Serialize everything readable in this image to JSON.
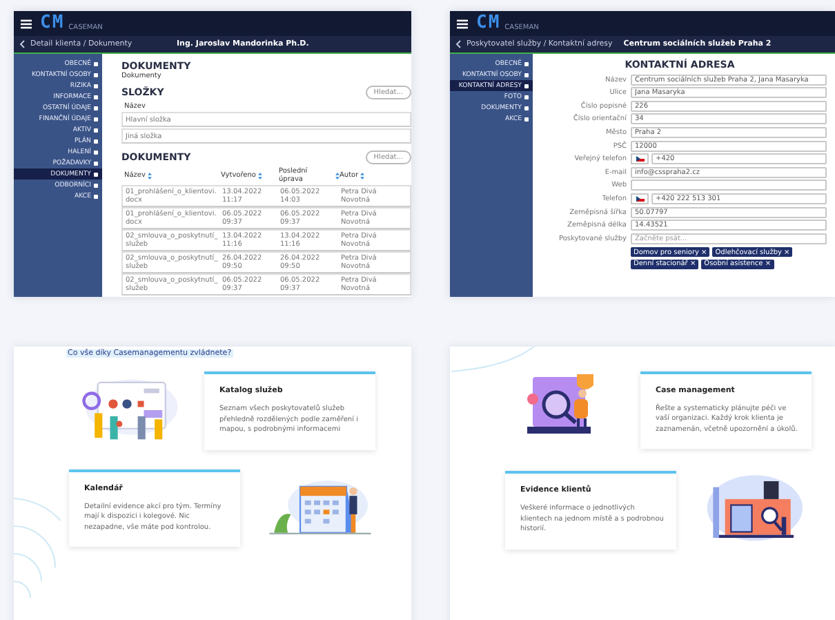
{
  "app_screens": [
    {
      "kind": "documents",
      "logo": "CM",
      "logo_caption": "CASEMAN",
      "breadcrumb": "Detail klienta / Dokumenty",
      "title": "Ing. Jaroslav Mandorinka Ph.D.",
      "menu": [
        {
          "label": "OBECNÉ",
          "selected": false
        },
        {
          "label": "KONTAKTNÍ OSOBY",
          "selected": false
        },
        {
          "label": "RIZIKA",
          "selected": false
        },
        {
          "label": "INFORMACE",
          "selected": false
        },
        {
          "label": "OSTATNÍ ÚDAJE",
          "selected": false
        },
        {
          "label": "FINANČNÍ ÚDAJE",
          "selected": false
        },
        {
          "label": "AKTIV",
          "selected": false
        },
        {
          "label": "PLÁN",
          "selected": false
        },
        {
          "label": "HALENÍ",
          "selected": false
        },
        {
          "label": "POŽADAVKY",
          "selected": false
        },
        {
          "label": "DOKUMENTY",
          "selected": true
        },
        {
          "label": "ODBORNÍCI",
          "selected": false
        },
        {
          "label": "AKCE",
          "selected": false
        }
      ],
      "heading": "DOKUMENTY",
      "subheading": "Dokumenty",
      "folders": {
        "heading": "SLOŽKY",
        "search": "Hledat...",
        "column": "Název",
        "rows": [
          "Hlavní složka",
          "Jiná složka"
        ]
      },
      "documents": {
        "heading": "DOKUMENTY",
        "search": "Hledat...",
        "columns": [
          "Název",
          "Vytvořeno",
          "Poslední úprava",
          "Autor"
        ],
        "rows": [
          [
            "01_prohlášení_o_klientovi.docx",
            "13.04.2022 11:17",
            "06.05.2022 14:03",
            "Petra Divá Novotná"
          ],
          [
            "01_prohlášení_o_klientovi.docx",
            "06.05.2022 09:37",
            "06.05.2022 09:37",
            "Petra Divá Novotná"
          ],
          [
            "02_smlouva_o_poskytnutí_služeb",
            "13.04.2022 11:16",
            "13.04.2022 11:16",
            "Petra Divá Novotná"
          ],
          [
            "02_smlouva_o_poskytnutí_služeb",
            "26.04.2022 09:50",
            "26.04.2022 09:50",
            "Petra Divá Novotná"
          ],
          [
            "02_smlouva_o_poskytnutí_služeb",
            "06.05.2022 09:37",
            "06.05.2022 09:37",
            "Petra Divá Novotná"
          ]
        ]
      }
    },
    {
      "kind": "address",
      "logo": "CM",
      "logo_caption": "CASEMAN",
      "breadcrumb": "Poskytovatel služby / Kontaktní adresy",
      "title": "Centrum sociálních služeb Praha 2",
      "menu": [
        {
          "label": "OBECNÉ",
          "selected": false
        },
        {
          "label": "KONTAKTNÍ OSOBY",
          "selected": false
        },
        {
          "label": "KONTAKTNÍ ADRESY",
          "selected": true
        },
        {
          "label": "FOTO",
          "selected": false
        },
        {
          "label": "DOKUMENTY",
          "selected": false
        },
        {
          "label": "AKCE",
          "selected": false
        }
      ],
      "heading": "KONTAKTNÍ ADRESA",
      "fields": [
        {
          "kind": "text",
          "label": "Název",
          "value": "Centrum sociálních služeb Praha 2, Jana Masaryka"
        },
        {
          "kind": "text",
          "label": "Ulice",
          "value": "Jana Masaryka"
        },
        {
          "kind": "text",
          "label": "Číslo popisné",
          "value": "226"
        },
        {
          "kind": "text",
          "label": "Číslo orientační",
          "value": "34"
        },
        {
          "kind": "text",
          "label": "Město",
          "value": "Praha 2"
        },
        {
          "kind": "text",
          "label": "PSČ",
          "value": "12000"
        },
        {
          "kind": "phone",
          "label": "Veřejný telefon",
          "value": "+420"
        },
        {
          "kind": "text",
          "label": "E-mail",
          "value": "info@csspraha2.cz"
        },
        {
          "kind": "text",
          "label": "Web"
        },
        {
          "kind": "phone",
          "label": "Telefon",
          "value": "+420 222 513 301"
        },
        {
          "kind": "text",
          "label": "Zeměpisná šířka",
          "value": "50.07797"
        },
        {
          "kind": "text",
          "label": "Zeměpisná délka",
          "value": "14.43521"
        },
        {
          "kind": "text",
          "label": "Poskytované služby",
          "placeholder": "Začněte psát..."
        }
      ],
      "tags": [
        "Domov pro seniory ×",
        "Odlehčovací služby ×",
        "Denní stacionář ×",
        "Osobní asistence ×"
      ]
    }
  ],
  "feature_panels": [
    {
      "heading": "Co vše díky Casemanagementu zvládnete?",
      "cards": [
        {
          "title": "Katalog služeb",
          "text": "Seznam všech poskytovatelů služeb přehledně rozdělených podle zaměření i mapou, s podrobnými informacemi"
        },
        {
          "title": "Kalendář",
          "text": "Detailní evidence akcí pro tým. Termíny mají k dispozici i kolegové. Nic nezapadne, vše máte pod kontrolou."
        }
      ]
    },
    {
      "cards": [
        {
          "title": "Case management",
          "text": "Řešte a systematicky plánujte péči ve vaší organizaci. Každý krok klienta je zaznamenán, včetně upozornění a úkolů."
        },
        {
          "title": "Evidence klientů",
          "text": "Veškeré informace o jednotlivých klientech na jednom místě a s podrobnou historií."
        }
      ]
    }
  ]
}
